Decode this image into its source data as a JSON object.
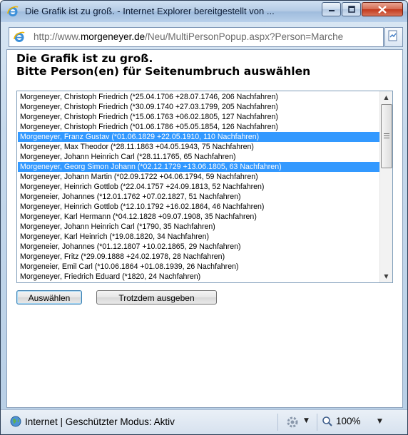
{
  "window": {
    "title": "Die Grafik ist zu groß. - Internet Explorer bereitgestellt von ...",
    "address_prefix": "http://www.",
    "address_domain": "morgeneyer.de",
    "address_path": "/Neu/MultiPersonPopup.aspx?Person=Marche"
  },
  "heading": {
    "line1": "Die Grafik ist zu groß.",
    "line2": "Bitte Person(en) für Seitenumbruch auswählen"
  },
  "list": {
    "items": [
      {
        "label": "Morgeneyer, Christoph Friedrich (*25.04.1706 +28.07.1746, 206 Nachfahren)",
        "selected": false
      },
      {
        "label": "Morgeneyer, Christoph Friedrich (*30.09.1740 +27.03.1799, 205 Nachfahren)",
        "selected": false
      },
      {
        "label": "Morgeneyer, Christoph Friedrich (*15.06.1763 +06.02.1805, 127 Nachfahren)",
        "selected": false
      },
      {
        "label": "Morgeneyer, Christoph Friedrich (*01.06.1786 +05.05.1854, 126 Nachfahren)",
        "selected": false
      },
      {
        "label": "Morgeneyer, Franz Gustav (*01.06.1829 +22.05.1910, 110 Nachfahren)",
        "selected": true
      },
      {
        "label": "Morgeneyer, Max Theodor (*28.11.1863 +04.05.1943, 75 Nachfahren)",
        "selected": false
      },
      {
        "label": "Morgeneyer, Johann Heinrich Carl (*28.11.1765, 65 Nachfahren)",
        "selected": false
      },
      {
        "label": "Morgeneyer, Georg Simon Johann (*02.12.1729 +13.06.1805, 63 Nachfahren)",
        "selected": true
      },
      {
        "label": "Morgeneyer, Johann Martin (*02.09.1722 +04.06.1794, 59 Nachfahren)",
        "selected": false
      },
      {
        "label": "Morgeneyer, Heinrich Gottlob (*22.04.1757 +24.09.1813, 52 Nachfahren)",
        "selected": false
      },
      {
        "label": "Morgeneier, Johannes (*12.01.1762 +07.02.1827, 51 Nachfahren)",
        "selected": false
      },
      {
        "label": "Morgeneyer, Heinrich Gottlob (*12.10.1792 +16.02.1864, 46 Nachfahren)",
        "selected": false
      },
      {
        "label": "Morgeneyer, Karl Hermann (*04.12.1828 +09.07.1908, 35 Nachfahren)",
        "selected": false
      },
      {
        "label": "Morgeneyer, Johann Heinrich Carl (*1790, 35 Nachfahren)",
        "selected": false
      },
      {
        "label": "Morgeneyer, Karl Heinrich (*19.08.1820, 34 Nachfahren)",
        "selected": false
      },
      {
        "label": "Morgeneier, Johannes (*01.12.1807 +10.02.1865, 29 Nachfahren)",
        "selected": false
      },
      {
        "label": "Morgeneyer, Fritz (*29.09.1888 +24.02.1978, 28 Nachfahren)",
        "selected": false
      },
      {
        "label": "Morgeneier, Emil Carl (*10.06.1864 +01.08.1939, 26 Nachfahren)",
        "selected": false
      },
      {
        "label": "Morgeneyer, Friedrich Eduard (*1820, 24 Nachfahren)",
        "selected": false
      }
    ]
  },
  "buttons": {
    "select_label": "Auswählen",
    "print_label": "Trotzdem ausgeben"
  },
  "status": {
    "zone_text": "Internet | Geschützter Modus: Aktiv",
    "zoom": "100%"
  }
}
